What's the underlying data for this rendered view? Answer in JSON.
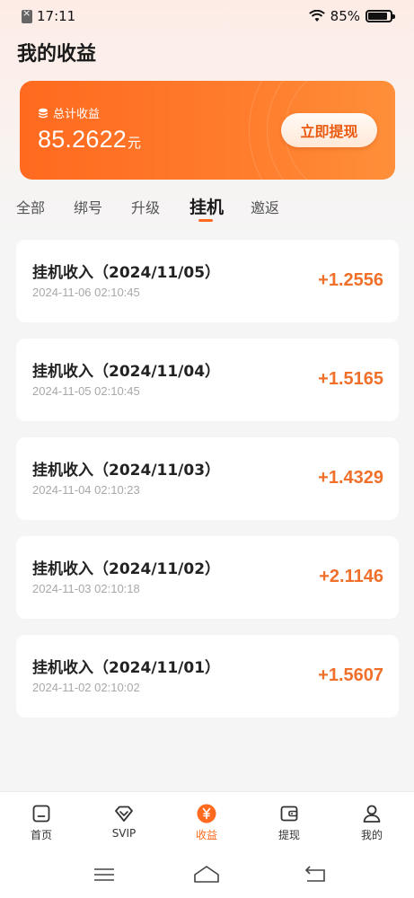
{
  "status_bar": {
    "time": "17:11",
    "battery": "85%"
  },
  "page_title": "我的收益",
  "earnings_card": {
    "label": "总计收益",
    "amount": "85.2622",
    "unit": "元",
    "withdraw_label": "立即提现"
  },
  "tabs": [
    {
      "label": "全部"
    },
    {
      "label": "绑号"
    },
    {
      "label": "升级"
    },
    {
      "label": "挂机",
      "active": true
    },
    {
      "label": "邀返"
    }
  ],
  "records": [
    {
      "title": "挂机收入（2024/11/05）",
      "time": "2024-11-06 02:10:45",
      "amount": "+1.2556"
    },
    {
      "title": "挂机收入（2024/11/04）",
      "time": "2024-11-05 02:10:45",
      "amount": "+1.5165"
    },
    {
      "title": "挂机收入（2024/11/03）",
      "time": "2024-11-04 02:10:23",
      "amount": "+1.4329"
    },
    {
      "title": "挂机收入（2024/11/02）",
      "time": "2024-11-03 02:10:18",
      "amount": "+2.1146"
    },
    {
      "title": "挂机收入（2024/11/01）",
      "time": "2024-11-02 02:10:02",
      "amount": "+1.5607"
    }
  ],
  "bottom_nav": [
    {
      "label": "首页",
      "icon": "home-icon"
    },
    {
      "label": "SVIP",
      "icon": "diamond-icon"
    },
    {
      "label": "收益",
      "icon": "yen-coin-icon",
      "active": true
    },
    {
      "label": "提现",
      "icon": "wallet-icon"
    },
    {
      "label": "我的",
      "icon": "user-icon"
    }
  ],
  "colors": {
    "accent": "#ff6a1f",
    "amount": "#f0702a"
  }
}
